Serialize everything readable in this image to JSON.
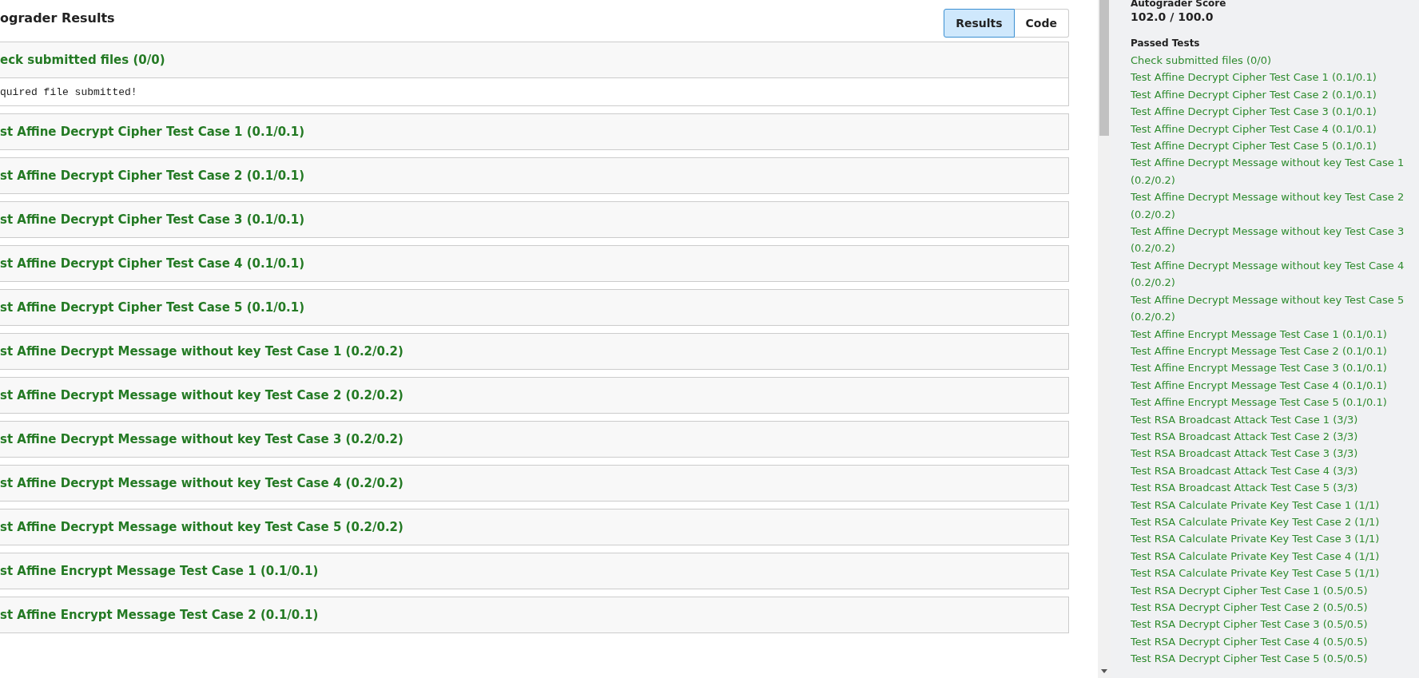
{
  "results": {
    "title": "ograder Results",
    "view_tabs": [
      {
        "label": "Results",
        "selected": true
      },
      {
        "label": "Code",
        "selected": false
      }
    ],
    "tests": [
      {
        "title": "eck submitted files (0/0)",
        "output": "quired file submitted!"
      },
      {
        "title": "st Affine Decrypt Cipher Test Case 1 (0.1/0.1)"
      },
      {
        "title": "st Affine Decrypt Cipher Test Case 2 (0.1/0.1)"
      },
      {
        "title": "st Affine Decrypt Cipher Test Case 3 (0.1/0.1)"
      },
      {
        "title": "st Affine Decrypt Cipher Test Case 4 (0.1/0.1)"
      },
      {
        "title": "st Affine Decrypt Cipher Test Case 5 (0.1/0.1)"
      },
      {
        "title": "st Affine Decrypt Message without key Test Case 1 (0.2/0.2)"
      },
      {
        "title": "st Affine Decrypt Message without key Test Case 2 (0.2/0.2)"
      },
      {
        "title": "st Affine Decrypt Message without key Test Case 3 (0.2/0.2)"
      },
      {
        "title": "st Affine Decrypt Message without key Test Case 4 (0.2/0.2)"
      },
      {
        "title": "st Affine Decrypt Message without key Test Case 5 (0.2/0.2)"
      },
      {
        "title": "st Affine Encrypt Message Test Case 1 (0.1/0.1)"
      },
      {
        "title": "st Affine Encrypt Message Test Case 2 (0.1/0.1)"
      }
    ]
  },
  "sidebar": {
    "score_label": "Autograder Score",
    "score": "102.0 / 100.0",
    "passed_heading": "Passed Tests",
    "passed_tests": [
      "Check submitted files (0/0)",
      "Test Affine Decrypt Cipher Test Case 1 (0.1/0.1)",
      "Test Affine Decrypt Cipher Test Case 2 (0.1/0.1)",
      "Test Affine Decrypt Cipher Test Case 3 (0.1/0.1)",
      "Test Affine Decrypt Cipher Test Case 4 (0.1/0.1)",
      "Test Affine Decrypt Cipher Test Case 5 (0.1/0.1)",
      "Test Affine Decrypt Message without key Test Case 1 (0.2/0.2)",
      "Test Affine Decrypt Message without key Test Case 2 (0.2/0.2)",
      "Test Affine Decrypt Message without key Test Case 3 (0.2/0.2)",
      "Test Affine Decrypt Message without key Test Case 4 (0.2/0.2)",
      "Test Affine Decrypt Message without key Test Case 5 (0.2/0.2)",
      "Test Affine Encrypt Message Test Case 1 (0.1/0.1)",
      "Test Affine Encrypt Message Test Case 2 (0.1/0.1)",
      "Test Affine Encrypt Message Test Case 3 (0.1/0.1)",
      "Test Affine Encrypt Message Test Case 4 (0.1/0.1)",
      "Test Affine Encrypt Message Test Case 5 (0.1/0.1)",
      "Test RSA Broadcast Attack Test Case 1 (3/3)",
      "Test RSA Broadcast Attack Test Case 2 (3/3)",
      "Test RSA Broadcast Attack Test Case 3 (3/3)",
      "Test RSA Broadcast Attack Test Case 4 (3/3)",
      "Test RSA Broadcast Attack Test Case 5 (3/3)",
      "Test RSA Calculate Private Key Test Case 1 (1/1)",
      "Test RSA Calculate Private Key Test Case 2 (1/1)",
      "Test RSA Calculate Private Key Test Case 3 (1/1)",
      "Test RSA Calculate Private Key Test Case 4 (1/1)",
      "Test RSA Calculate Private Key Test Case 5 (1/1)",
      "Test RSA Decrypt Cipher Test Case 1 (0.5/0.5)",
      "Test RSA Decrypt Cipher Test Case 2 (0.5/0.5)",
      "Test RSA Decrypt Cipher Test Case 3 (0.5/0.5)",
      "Test RSA Decrypt Cipher Test Case 4 (0.5/0.5)",
      "Test RSA Decrypt Cipher Test Case 5 (0.5/0.5)"
    ]
  }
}
